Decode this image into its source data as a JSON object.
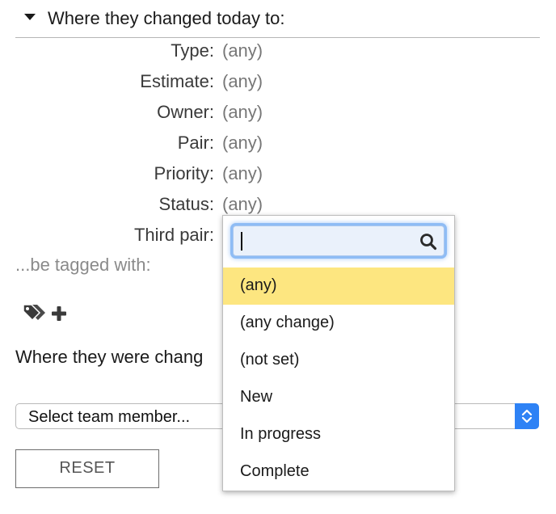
{
  "section": {
    "title": "Where they changed today to:"
  },
  "fields": [
    {
      "label": "Type:",
      "value": "(any)"
    },
    {
      "label": "Estimate:",
      "value": "(any)"
    },
    {
      "label": "Owner:",
      "value": "(any)"
    },
    {
      "label": "Pair:",
      "value": "(any)"
    },
    {
      "label": "Priority:",
      "value": "(any)"
    },
    {
      "label": "Status:",
      "value": "(any)"
    },
    {
      "label": "Third pair:",
      "value": ""
    }
  ],
  "tagged": {
    "label": "...be tagged with:",
    "icons": [
      "tags-icon",
      "plus-icon"
    ]
  },
  "changed_by": {
    "label": "Where they were chang"
  },
  "team_select": {
    "selected": "Select team member..."
  },
  "reset": {
    "label": "RESET"
  },
  "dropdown": {
    "search_value": "",
    "options": [
      {
        "label": "(any)",
        "selected": true
      },
      {
        "label": "(any change)",
        "selected": false
      },
      {
        "label": "(not set)",
        "selected": false
      },
      {
        "label": "New",
        "selected": false
      },
      {
        "label": "In progress",
        "selected": false
      },
      {
        "label": "Complete",
        "selected": false
      }
    ]
  },
  "colors": {
    "highlight": "#fde680",
    "focus_ring": "#8ebcf5",
    "select_stepper": "#2e82f5"
  }
}
